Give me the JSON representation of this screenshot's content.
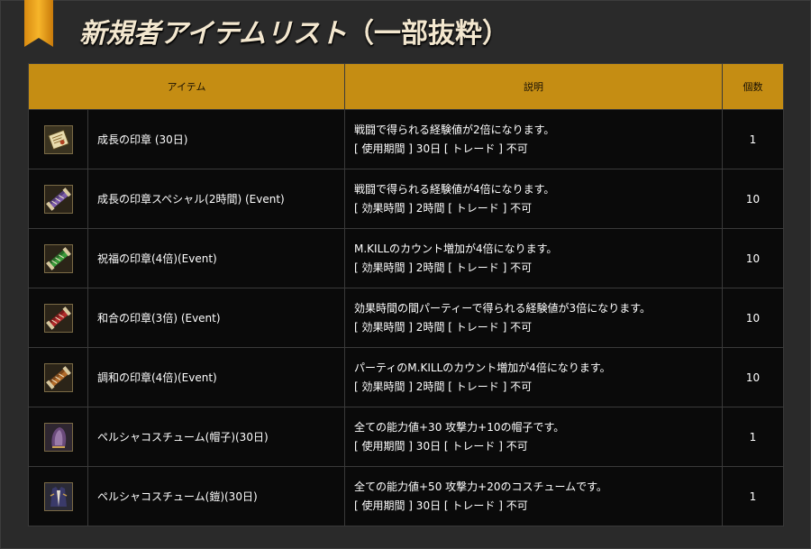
{
  "page": {
    "title": "新規者アイテムリスト",
    "title_paren": "（一部抜粋）",
    "accent_color": "#c58d13"
  },
  "table": {
    "headers": {
      "item": "アイテム",
      "desc": "説明",
      "qty": "個数"
    },
    "rows": [
      {
        "icon": "seal-scroll-icon",
        "name": "成長の印章 (30日)",
        "desc_line1": "戦闘で得られる経験値が2倍になります。",
        "desc_line2": "[ 使用期間 ] 30日 [ トレード ] 不可",
        "qty": "1"
      },
      {
        "icon": "purple-scroll-icon",
        "name": "成長の印章スペシャル(2時間) (Event)",
        "desc_line1": "戦闘で得られる経験値が4倍になります。",
        "desc_line2": "[ 効果時間 ] 2時間 [ トレード ] 不可",
        "qty": "10"
      },
      {
        "icon": "green-scroll-icon",
        "name": "祝福の印章(4倍)(Event)",
        "desc_line1": "M.KILLのカウント増加が4倍になります。",
        "desc_line2": "[ 効果時間 ] 2時間 [ トレード ] 不可",
        "qty": "10"
      },
      {
        "icon": "red-scroll-icon",
        "name": "和合の印章(3倍) (Event)",
        "desc_line1": "効果時間の間パーティーで得られる経験値が3倍になります。",
        "desc_line2": "[ 効果時間 ] 2時間 [ トレード ] 不可",
        "qty": "10"
      },
      {
        "icon": "orange-scroll-icon",
        "name": "調和の印章(4倍)(Event)",
        "desc_line1": "パーティのM.KILLのカウント増加が4倍になります。",
        "desc_line2": "[ 効果時間 ] 2時間 [ トレード ] 不可",
        "qty": "10"
      },
      {
        "icon": "hat-costume-icon",
        "name": "ペルシャコスチューム(帽子)(30日)",
        "desc_line1": "全ての能力値+30 攻撃力+10の帽子です。",
        "desc_line2": "[ 使用期間 ] 30日 [ トレード ] 不可",
        "qty": "1"
      },
      {
        "icon": "armor-costume-icon",
        "name": "ペルシャコスチューム(鎧)(30日)",
        "desc_line1": "全ての能力値+50 攻撃力+20のコスチュームです。",
        "desc_line2": "[ 使用期間 ] 30日 [ トレード ] 不可",
        "qty": "1"
      }
    ]
  }
}
